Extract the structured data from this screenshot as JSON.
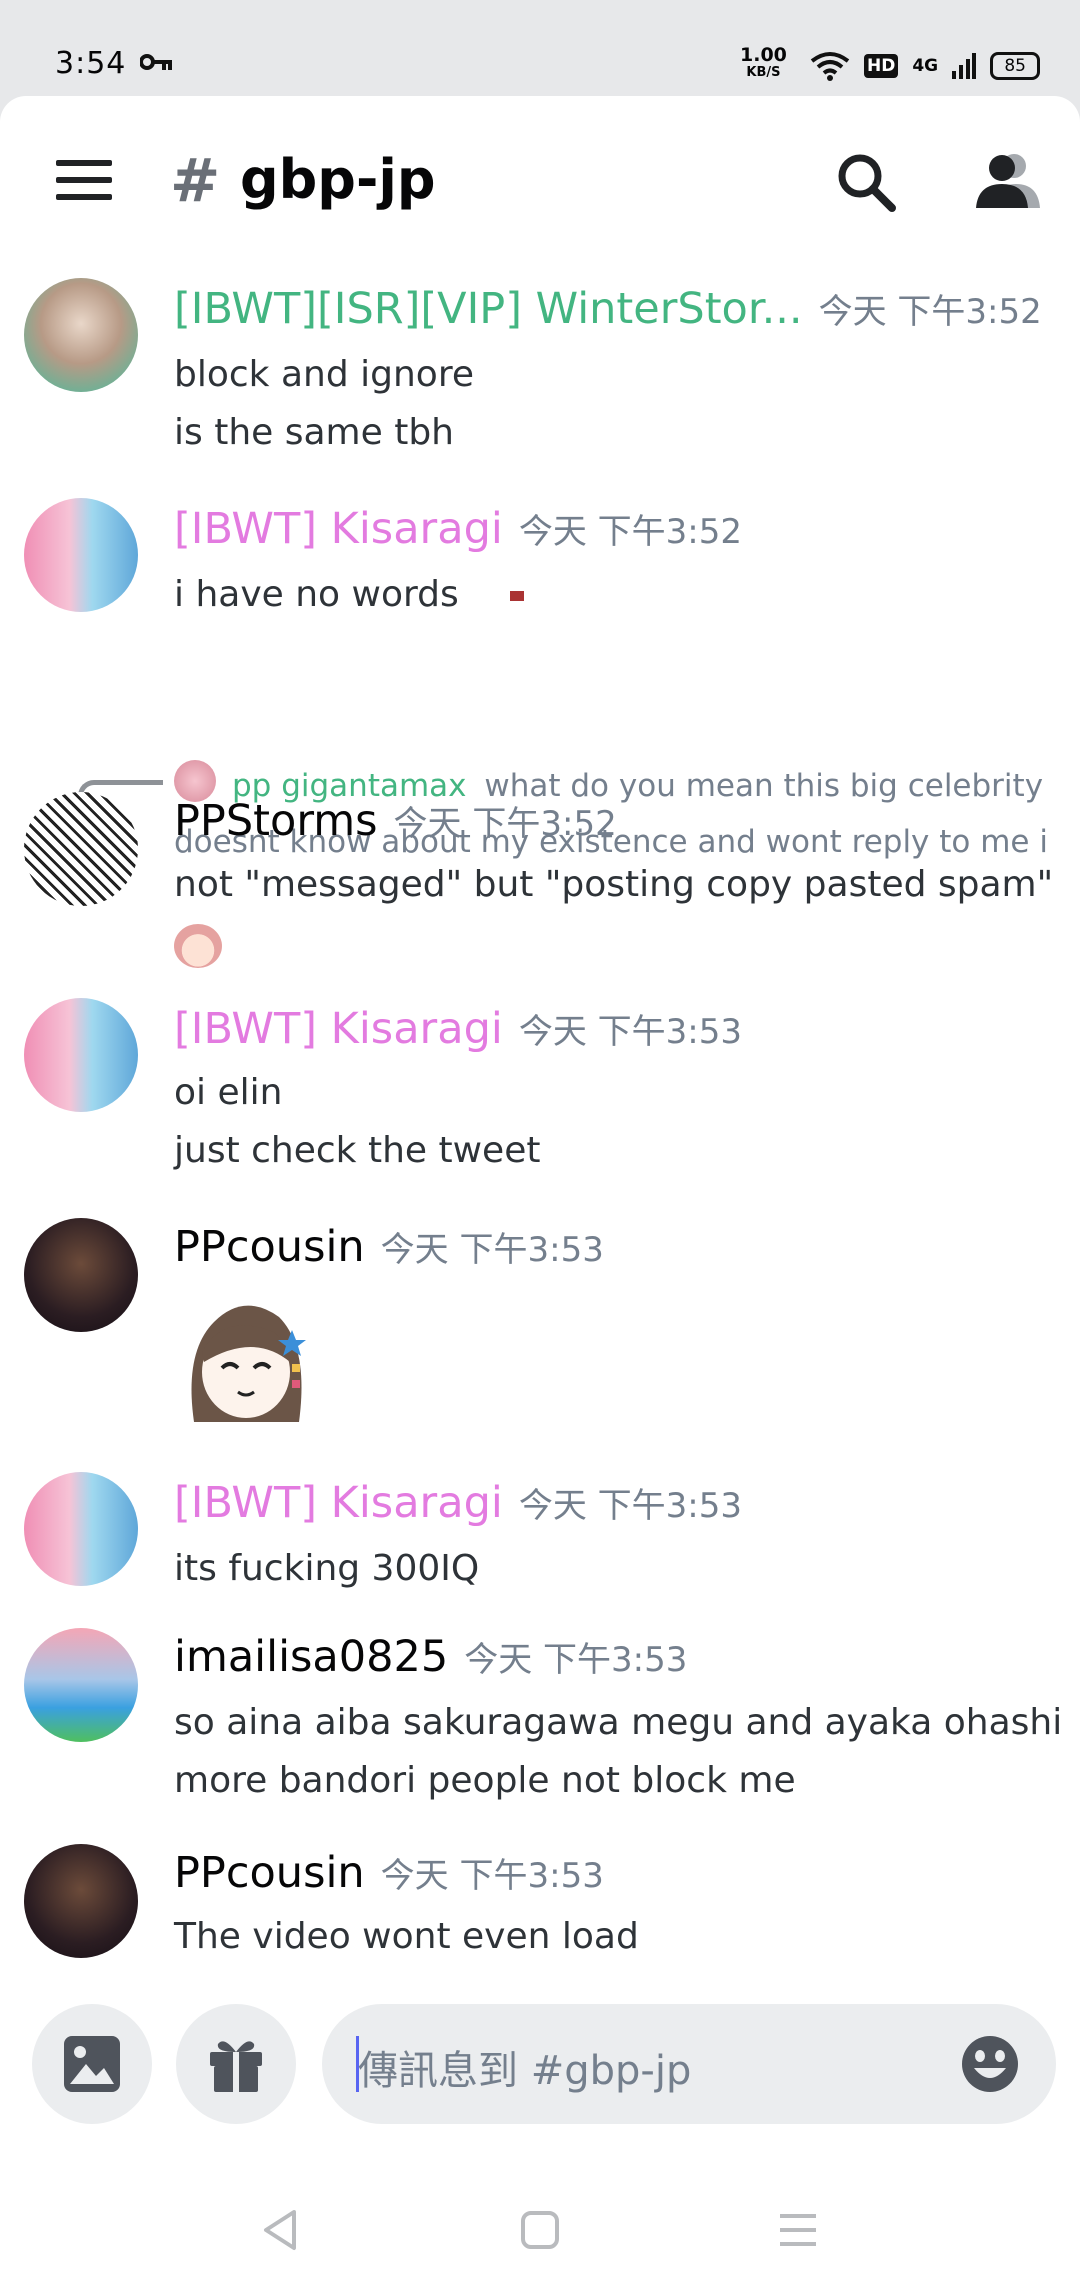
{
  "status": {
    "time": "3:54",
    "speed_value": "1.00",
    "speed_unit": "KB/S",
    "hd": "HD",
    "network": "4G",
    "battery": "85"
  },
  "header": {
    "hash": "#",
    "channel": "gbp-jp"
  },
  "messages": [
    {
      "user": "[IBWT][ISR][VIP] WinterStor...",
      "time": "今天 下午3:52",
      "lines": [
        "block and ignore",
        "is the same tbh"
      ]
    },
    {
      "user": "[IBWT] Kisaragi",
      "time": "今天 下午3:52",
      "lines": [
        "i have no words"
      ]
    },
    {
      "user": "PPStorms",
      "time": "今天 下午3:52",
      "lines": [
        "not \"messaged\" but \"posting copy pasted spam\""
      ]
    },
    {
      "user": "[IBWT] Kisaragi",
      "time": "今天 下午3:53",
      "lines": [
        "oi elin",
        "just check the tweet"
      ]
    },
    {
      "user": "PPcousin",
      "time": "今天 下午3:53",
      "lines": []
    },
    {
      "user": "[IBWT] Kisaragi",
      "time": "今天 下午3:53",
      "lines": [
        "its fucking 300IQ"
      ]
    },
    {
      "user": "imailisa0825",
      "time": "今天 下午3:53",
      "lines": [
        "so aina aiba sakuragawa megu and ayaka ohashi",
        "more bandori people not block me"
      ]
    },
    {
      "user": "PPcousin",
      "time": "今天 下午3:53",
      "lines": [
        "The video wont even load"
      ]
    }
  ],
  "reply": {
    "user": "pp gigantamax",
    "text_line1": "what do you mean this big celebrity",
    "text_line2": "doesnt know about my existence and wont reply to me i"
  },
  "composer": {
    "placeholder": "傳訊息到 #gbp-jp"
  },
  "colors": {
    "green_role": "#43b581",
    "pink_role": "#e37be0",
    "timestamp": "#747f8d"
  }
}
